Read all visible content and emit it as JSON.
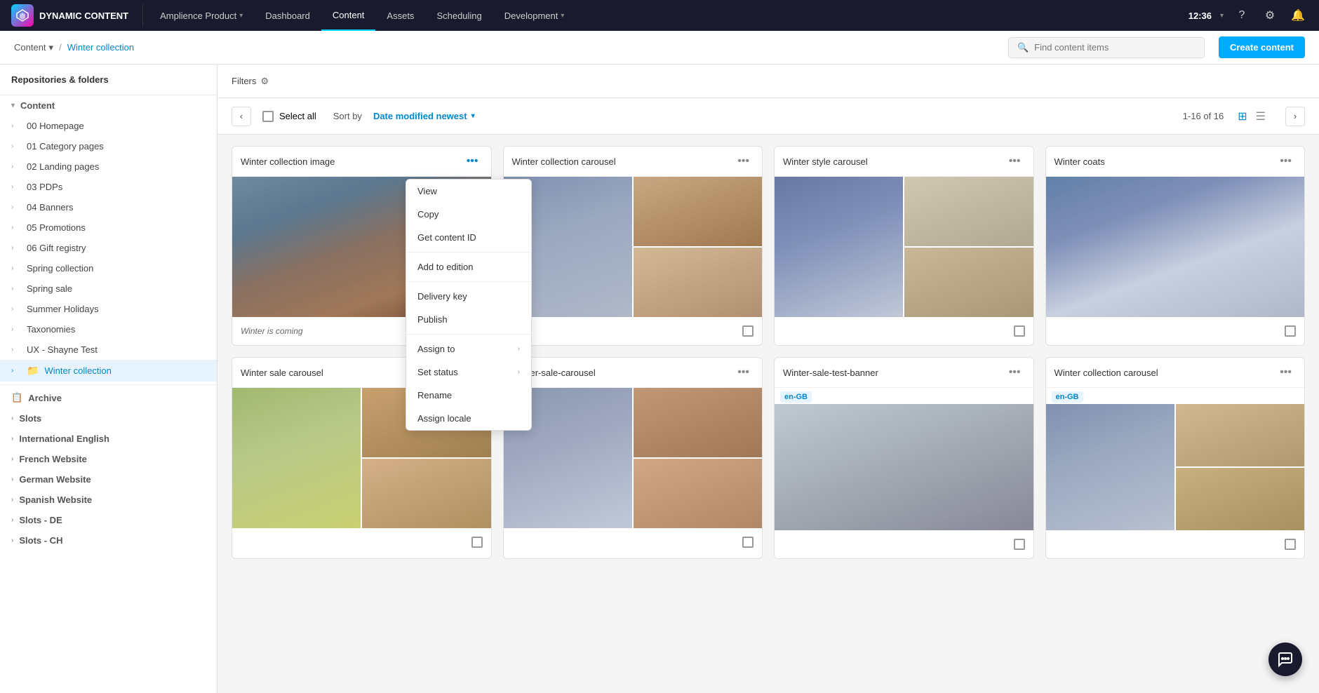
{
  "app": {
    "logo_text": "DYNAMIC CONTENT",
    "time": "12:36"
  },
  "nav": {
    "items": [
      {
        "label": "Amplience Product",
        "has_caret": true,
        "active": false
      },
      {
        "label": "Dashboard",
        "has_caret": false,
        "active": false
      },
      {
        "label": "Content",
        "has_caret": false,
        "active": true
      },
      {
        "label": "Assets",
        "has_caret": false,
        "active": false
      },
      {
        "label": "Scheduling",
        "has_caret": false,
        "active": false
      },
      {
        "label": "Development",
        "has_caret": true,
        "active": false
      }
    ]
  },
  "breadcrumb": {
    "root": "Content",
    "separator": "/",
    "current": "Winter collection"
  },
  "search": {
    "placeholder": "Find content items"
  },
  "create_button": "Create content",
  "sidebar": {
    "section_title": "Repositories & folders",
    "top_item": "Content",
    "items": [
      {
        "label": "00 Homepage",
        "indent": 1
      },
      {
        "label": "01 Category pages",
        "indent": 1
      },
      {
        "label": "02 Landing pages",
        "indent": 1
      },
      {
        "label": "03 PDPs",
        "indent": 1
      },
      {
        "label": "04 Banners",
        "indent": 1
      },
      {
        "label": "05 Promotions",
        "indent": 1
      },
      {
        "label": "06 Gift registry",
        "indent": 1
      },
      {
        "label": "Spring collection",
        "indent": 1
      },
      {
        "label": "Spring sale",
        "indent": 1
      },
      {
        "label": "Summer Holidays",
        "indent": 1
      },
      {
        "label": "Taxonomies",
        "indent": 1
      },
      {
        "label": "UX - Shayne Test",
        "indent": 1
      },
      {
        "label": "Winter collection",
        "indent": 1,
        "active": true
      }
    ],
    "archive": "Archive",
    "sub_items": [
      {
        "label": "Slots",
        "indent": 0
      },
      {
        "label": "International English",
        "indent": 0
      },
      {
        "label": "French Website",
        "indent": 0
      },
      {
        "label": "German Website",
        "indent": 0
      },
      {
        "label": "Spanish Website",
        "indent": 0
      },
      {
        "label": "Slots - DE",
        "indent": 0
      },
      {
        "label": "Slots - CH",
        "indent": 0
      }
    ]
  },
  "toolbar": {
    "filters_label": "Filters",
    "select_all_label": "Select all",
    "sort_prefix": "Sort by",
    "sort_value": "Date modified newest",
    "pagination": "1-16 of 16"
  },
  "context_menu": {
    "items": [
      {
        "label": "View",
        "has_caret": false
      },
      {
        "label": "Copy",
        "has_caret": false
      },
      {
        "label": "Get content ID",
        "has_caret": false
      },
      {
        "divider": true
      },
      {
        "label": "Add to edition",
        "has_caret": false
      },
      {
        "divider": true
      },
      {
        "label": "Delivery key",
        "has_caret": false
      },
      {
        "label": "Publish",
        "has_caret": false
      },
      {
        "divider": true
      },
      {
        "label": "Assign to",
        "has_caret": true
      },
      {
        "label": "Set status",
        "has_caret": true
      },
      {
        "label": "Rename",
        "has_caret": false
      },
      {
        "label": "Assign locale",
        "has_caret": false
      }
    ]
  },
  "cards": [
    {
      "title": "Winter collection image",
      "type": "single",
      "image_style": "img-single-woman",
      "caption": "Winter is coming",
      "has_menu": true,
      "locale": null
    },
    {
      "title": "Winter collection carousel",
      "type": "multi",
      "caption": null,
      "has_menu": false,
      "locale": null
    },
    {
      "title": "Winter style carousel",
      "type": "multi2",
      "caption": null,
      "has_menu": false,
      "locale": null
    },
    {
      "title": "Winter coats",
      "type": "single",
      "image_style": "img-winter-coat",
      "caption": null,
      "has_menu": false,
      "locale": null
    },
    {
      "title": "Winter sale carousel",
      "type": "multi3",
      "caption": null,
      "has_menu": false,
      "locale": null
    },
    {
      "title": "Winter-sale-carousel",
      "type": "multi4",
      "caption": null,
      "has_menu": false,
      "locale": null
    },
    {
      "title": "Winter-sale-test-banner",
      "type": "single",
      "image_style": "img-grey-coat",
      "caption": null,
      "has_menu": false,
      "locale": "en-GB"
    },
    {
      "title": "Winter collection carousel",
      "type": "multi5",
      "caption": null,
      "has_menu": false,
      "locale": "en-GB"
    }
  ]
}
